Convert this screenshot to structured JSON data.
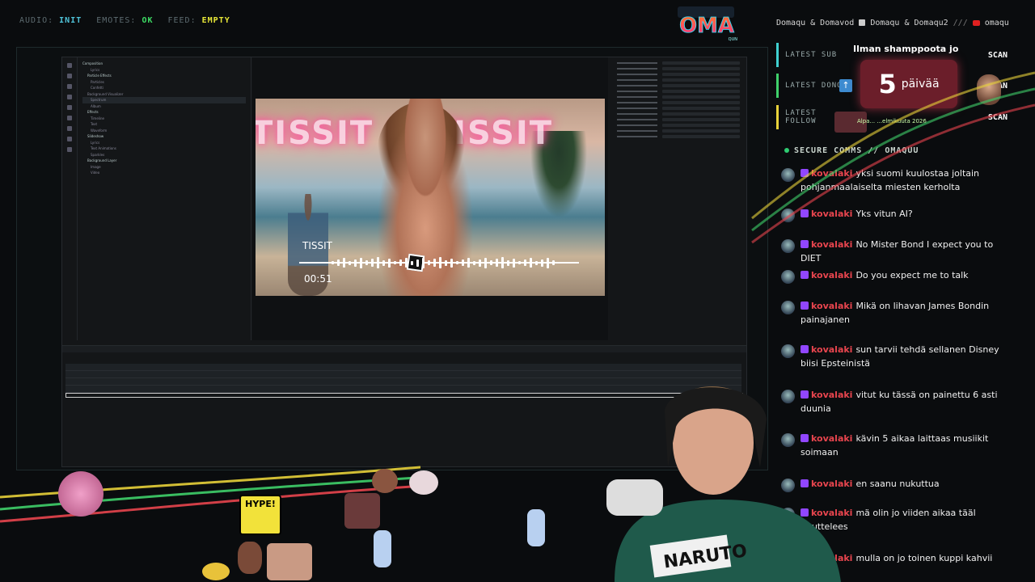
{
  "status": {
    "audio_label": "AUDIO:",
    "audio_value": "INIT",
    "emotes_label": "EMOTES:",
    "emotes_value": "OK",
    "feed_label": "FEED:",
    "feed_value": "EMPTY",
    "colors": {
      "init": "#4fc3d9",
      "ok": "#3ddc64",
      "empty": "#e8e838"
    }
  },
  "logo": {
    "text": "OMA",
    "sub": "QUN"
  },
  "ticker": {
    "item1": "Domaqu & Domavod",
    "item2": "Domaqu & Domaqu2",
    "separator": "///",
    "item3": "omaqu"
  },
  "alerts": {
    "headline": "Ilman shamppoota jo",
    "days_number": "5",
    "days_word": "päivää",
    "follow_sub": "Alpa... ...elmikuuta 2026",
    "rows": [
      {
        "label": "LATEST SUB",
        "value": "SCAN",
        "color": "#3fd0d0"
      },
      {
        "label": "LATEST DONO",
        "value": "SCAN",
        "color": "#3fd06a"
      },
      {
        "label": "LATEST FOLLOW",
        "value": "SCAN",
        "color": "#e8d23a"
      }
    ]
  },
  "chat": {
    "title": "SECURE COMMS // OMAQUU",
    "messages": [
      {
        "user": "kovalaki",
        "text": "yksi suomi kuulostaa joltain pohjanmaalaiselta miesten kerholta"
      },
      {
        "user": "kovalaki",
        "text": "Yks vitun AI?"
      },
      {
        "user": "kovalaki",
        "text": "No Mister Bond I expect you to DIET"
      },
      {
        "user": "kovalaki",
        "text": "Do you expect me to talk"
      },
      {
        "user": "kovalaki",
        "text": "Mikä on lihavan James Bondin painajanen"
      },
      {
        "user": "kovalaki",
        "text": "sun tarvii tehdä sellanen Disney biisi Epsteinistä"
      },
      {
        "user": "kovalaki",
        "text": "vitut ku tässä on painettu 6 asti duunia"
      },
      {
        "user": "kovalaki",
        "text": "kävin 5 aikaa laittaas musiikit soimaan"
      },
      {
        "user": "kovalaki",
        "text": "en saanu nukuttua"
      },
      {
        "user": "kovalaki",
        "text": "mä olin jo viiden aikaa tääl nputtelees"
      },
      {
        "user": "kovalaki",
        "text": "mulla on jo toinen kuppi kahvii"
      }
    ]
  },
  "editor": {
    "layers": [
      "Composition",
      "Lyrics",
      "Particle Effects",
      "Particles",
      "Confetti",
      "Background Visualizer",
      "Spectrum",
      "Album",
      "Effects",
      "Timeline",
      "Text",
      "Waveform",
      "Slideshow",
      "Lyrics",
      "Text Animations",
      "Sparkles",
      "Background Layer",
      "Image",
      "Video"
    ],
    "preview": {
      "neon_text": "TISSIT ♡ TISSIT",
      "track_name": "TISSIT",
      "track_time": "00:51",
      "progress": 0.41
    }
  },
  "overlay": {
    "hype_text": "HYPE!",
    "shirt_text": "NARUTO"
  }
}
